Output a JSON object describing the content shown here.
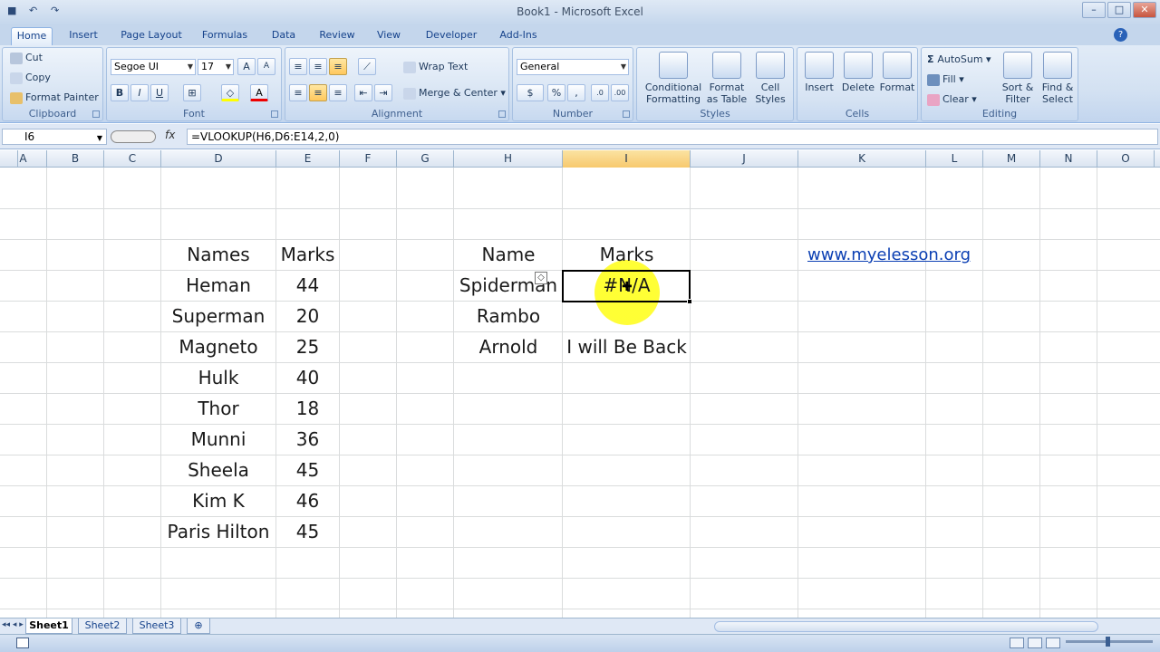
{
  "window": {
    "title": "Book1 - Microsoft Excel"
  },
  "ribbon_tabs": [
    "Home",
    "Insert",
    "Page Layout",
    "Formulas",
    "Data",
    "Review",
    "View",
    "Developer",
    "Add-Ins"
  ],
  "clipboard": {
    "cut": "Cut",
    "copy": "Copy",
    "format_painter": "Format Painter",
    "label": "Clipboard"
  },
  "font": {
    "name": "Segoe UI",
    "size": "17",
    "label": "Font",
    "bold": "B",
    "italic": "I",
    "underline": "U"
  },
  "alignment": {
    "wrap_text": "Wrap Text",
    "merge_center": "Merge & Center",
    "label": "Alignment"
  },
  "number": {
    "format": "General",
    "currency": "$",
    "percent": "%",
    "comma": ",",
    "label": "Number"
  },
  "styles": {
    "conditional": "Conditional Formatting",
    "format_table": "Format as Table",
    "cell_styles": "Cell Styles",
    "label": "Styles"
  },
  "cells": {
    "insert": "Insert",
    "delete": "Delete",
    "format": "Format",
    "label": "Cells"
  },
  "editing": {
    "autosum": "AutoSum",
    "fill": "Fill",
    "clear": "Clear",
    "sort_filter": "Sort & Filter",
    "find_select": "Find & Select",
    "label": "Editing"
  },
  "formula_bar": {
    "name_box": "I6",
    "fx": "fx",
    "formula": "=VLOOKUP(H6,D6:E14,2,0)"
  },
  "columns": [
    "A",
    "B",
    "C",
    "D",
    "E",
    "F",
    "G",
    "H",
    "I",
    "J",
    "K",
    "L",
    "M",
    "N",
    "O"
  ],
  "selected_column": "I",
  "table1": {
    "header_name": "Names",
    "header_marks": "Marks",
    "rows": [
      {
        "name": "Heman",
        "marks": "44"
      },
      {
        "name": "Superman",
        "marks": "20"
      },
      {
        "name": "Magneto",
        "marks": "25"
      },
      {
        "name": "Hulk",
        "marks": "40"
      },
      {
        "name": "Thor",
        "marks": "18"
      },
      {
        "name": "Munni",
        "marks": "36"
      },
      {
        "name": "Sheela",
        "marks": "45"
      },
      {
        "name": "Kim K",
        "marks": "46"
      },
      {
        "name": "Paris Hilton",
        "marks": "45"
      }
    ]
  },
  "table2": {
    "header_name": "Name",
    "header_marks": "Marks",
    "rows": [
      {
        "name": "Spiderman",
        "marks": "#N/A"
      },
      {
        "name": "Rambo",
        "marks": ""
      },
      {
        "name": "Arnold",
        "marks": "I will Be Back"
      }
    ]
  },
  "link": "www.myelesson.org",
  "sheets": [
    "Sheet1",
    "Sheet2",
    "Sheet3"
  ],
  "active_sheet": "Sheet1"
}
